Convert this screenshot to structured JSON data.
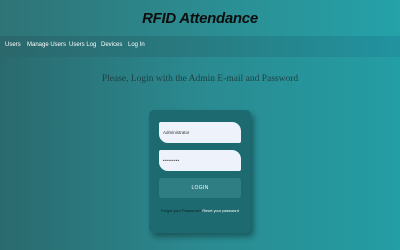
{
  "app": {
    "title": "RFID Attendance"
  },
  "nav": {
    "items": [
      "Users",
      "Manage Users",
      "Users Log",
      "Devices",
      "Log In"
    ]
  },
  "login": {
    "prompt": "Please, Login with the Admin E-mail and Password",
    "email_value": "Administrator",
    "password_value": "••••••••",
    "button_label": "LOGIN",
    "forgot_text": "Forgot your Password?",
    "reset_link": "Reset your password"
  },
  "colors": {
    "accent": "#2f7e84",
    "card": "#1d6a70",
    "field": "#eef3fb"
  }
}
